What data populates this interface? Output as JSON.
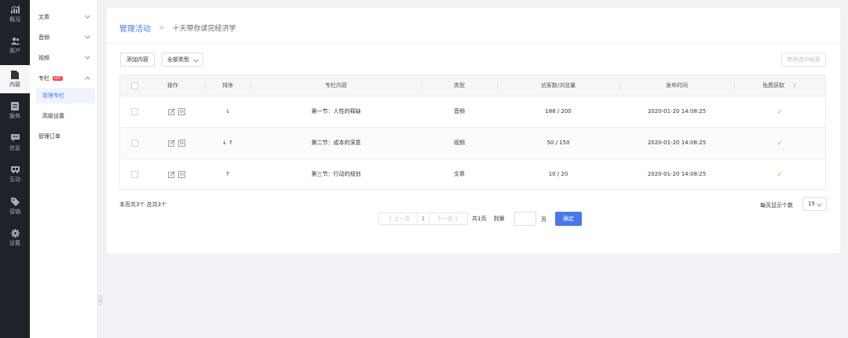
{
  "rail": {
    "items": [
      {
        "label": "概况",
        "icon": "chart-icon"
      },
      {
        "label": "客户",
        "icon": "users-icon"
      },
      {
        "label": "内容",
        "icon": "document-icon"
      },
      {
        "label": "服务",
        "icon": "service-icon"
      },
      {
        "label": "信息",
        "icon": "message-icon"
      },
      {
        "label": "互动",
        "icon": "interact-icon"
      },
      {
        "label": "营销",
        "icon": "tag-icon"
      },
      {
        "label": "设置",
        "icon": "gear-icon"
      }
    ],
    "active_index": 2
  },
  "subnav": {
    "items": [
      {
        "label": "文章"
      },
      {
        "label": "音频"
      },
      {
        "label": "视频"
      },
      {
        "label": "专栏",
        "badge": "HOT"
      },
      {
        "label": "管理专栏"
      },
      {
        "label": "高级设置"
      },
      {
        "label": "管理订单"
      }
    ]
  },
  "breadcrumb": {
    "root": "管理活动",
    "separator": ">",
    "current": "十天带你读完经济学"
  },
  "toolbar": {
    "add_label": "添加内容",
    "type_select": "全部类型",
    "remove_label": "移除选中结果"
  },
  "table": {
    "headers": [
      "操作",
      "排序",
      "专栏内容",
      "类型",
      "访客数/浏览量",
      "发布时间",
      "免费获取"
    ],
    "rows": [
      {
        "sort": "↓",
        "title": "第一节：人性的释缺",
        "type": "音频",
        "stats": "188 / 200",
        "date": "2020-01-20 14:08:25",
        "free": "✓"
      },
      {
        "sort": "↓ ↑",
        "title": "第二节：成本的深意",
        "type": "视频",
        "stats": "50 / 150",
        "date": "2020-01-20 14:08:25",
        "free": "✓"
      },
      {
        "sort": "↑",
        "title": "第三节：行动的规划",
        "type": "文章",
        "stats": "10 / 20",
        "date": "2020-01-20 14:08:25",
        "free": "✓"
      }
    ]
  },
  "footer": {
    "summary": "本页共3个  总共3个",
    "prev": "《 上一页",
    "page": "1",
    "next": "下一页 》",
    "total_pages": "共1页",
    "goto_label": "到第",
    "page_unit": "页",
    "confirm": "确定",
    "per_page_label": "每页显示个数",
    "per_page_value": "15"
  },
  "colors": {
    "accent": "#4a78e8",
    "rail_bg": "#1f2329",
    "check": "#6cbf3a",
    "hot": "#f5494c"
  }
}
